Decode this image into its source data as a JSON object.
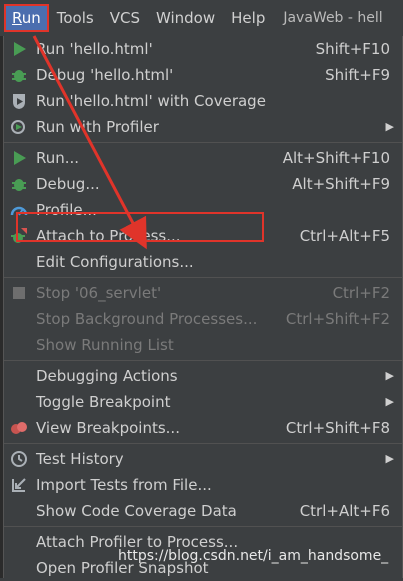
{
  "menubar": {
    "items": [
      "Run",
      "Tools",
      "VCS",
      "Window",
      "Help"
    ],
    "title": "JavaWeb - hell"
  },
  "menu": [
    {
      "label": "Run 'hello.html'",
      "shortcut": "Shift+F10",
      "icon": "run-icon"
    },
    {
      "label": "Debug 'hello.html'",
      "shortcut": "Shift+F9",
      "icon": "debug-icon"
    },
    {
      "label": "Run 'hello.html' with Coverage",
      "shortcut": "",
      "icon": "coverage-icon"
    },
    {
      "label": "Run with Profiler",
      "shortcut": "",
      "submenu": true,
      "icon": "profiler-icon"
    },
    {
      "label": "Run...",
      "shortcut": "Alt+Shift+F10",
      "icon": "run-icon"
    },
    {
      "label": "Debug...",
      "shortcut": "Alt+Shift+F9",
      "icon": "debug-icon"
    },
    {
      "label": "Profile...",
      "shortcut": "",
      "icon": "profile-icon"
    },
    {
      "label": "Attach to Process...",
      "shortcut": "Ctrl+Alt+F5",
      "icon": "attach-icon"
    },
    {
      "label": "Edit Configurations...",
      "shortcut": ""
    },
    {
      "label": "Stop '06_servlet'",
      "shortcut": "Ctrl+F2",
      "disabled": true,
      "icon": "stop-icon"
    },
    {
      "label": "Stop Background Processes...",
      "shortcut": "Ctrl+Shift+F2",
      "disabled": true
    },
    {
      "label": "Show Running List",
      "shortcut": "",
      "disabled": true
    },
    {
      "label": "Debugging Actions",
      "shortcut": "",
      "submenu": true
    },
    {
      "label": "Toggle Breakpoint",
      "shortcut": "",
      "submenu": true
    },
    {
      "label": "View Breakpoints...",
      "shortcut": "Ctrl+Shift+F8",
      "icon": "breakpoints-icon"
    },
    {
      "label": "Test History",
      "shortcut": "",
      "submenu": true,
      "icon": "clock-icon"
    },
    {
      "label": "Import Tests from File...",
      "shortcut": "",
      "icon": "import-icon"
    },
    {
      "label": "Show Code Coverage Data",
      "shortcut": "Ctrl+Alt+F6"
    },
    {
      "label": "Attach Profiler to Process...",
      "shortcut": ""
    },
    {
      "label": "Open Profiler Snapshot",
      "shortcut": ""
    }
  ],
  "watermark": "https://blog.csdn.net/i_am_handsome_"
}
